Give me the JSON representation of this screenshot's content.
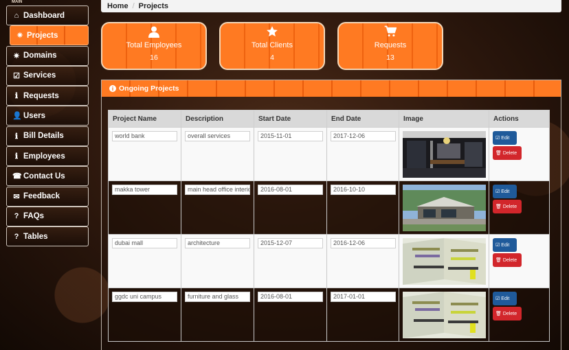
{
  "sidebar": {
    "heading": "MAIN",
    "items": [
      {
        "label": "Dashboard",
        "icon": "⌂"
      },
      {
        "label": "Projects",
        "icon": "✷"
      },
      {
        "label": "Domains",
        "icon": "✷"
      },
      {
        "label": "Services",
        "icon": "☑"
      },
      {
        "label": "Requests",
        "icon": "ℹ"
      },
      {
        "label": "Users",
        "icon": "👤"
      },
      {
        "label": "Bill Details",
        "icon": "ℹ"
      },
      {
        "label": "Employees",
        "icon": "ℹ"
      },
      {
        "label": "Contact Us",
        "icon": "☎"
      },
      {
        "label": "Feedback",
        "icon": "✉"
      },
      {
        "label": "FAQs",
        "icon": "?"
      },
      {
        "label": "Tables",
        "icon": "?"
      }
    ]
  },
  "breadcrumb": {
    "home": "Home",
    "separator": "/",
    "current": "Projects"
  },
  "stats": [
    {
      "label": "Total Employees",
      "value": "16",
      "icon": "user-icon"
    },
    {
      "label": "Total Clients",
      "value": "4",
      "icon": "star-icon"
    },
    {
      "label": "Requests",
      "value": "13",
      "icon": "cart-icon"
    }
  ],
  "panel": {
    "title": "Ongoing Projects",
    "columns": [
      "Project Name",
      "Description",
      "Start Date",
      "End Date",
      "Image",
      "Actions"
    ],
    "rows": [
      {
        "name": "world bank",
        "description": "overall services",
        "start": "2015-11-01",
        "end": "2017-12-06",
        "image": "dark office interior"
      },
      {
        "name": "makka tower",
        "description": "main head office interior",
        "start": "2016-08-01",
        "end": "2016-10-10",
        "image": "modern building exterior"
      },
      {
        "name": "dubai mall",
        "description": "architecture",
        "start": "2015-12-07",
        "end": "2016-12-06",
        "image": "shelving unit interior"
      },
      {
        "name": "ggdc uni campus",
        "description": "furniture and glass",
        "start": "2016-08-01",
        "end": "2017-01-01",
        "image": "shelving unit interior"
      }
    ],
    "edit_label": "Edit",
    "delete_label": "Delete"
  },
  "colors": {
    "accent": "#ff7a22",
    "edit": "#1f5a9a",
    "delete": "#d2262b"
  }
}
